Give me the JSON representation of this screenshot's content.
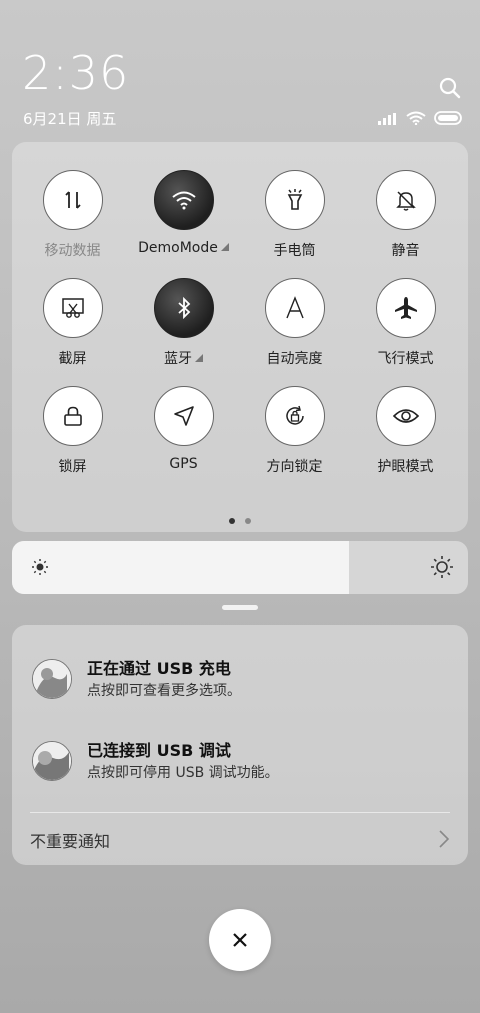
{
  "status_bar": {
    "time": "2:36",
    "date": "6月21日 周五"
  },
  "quick_settings": {
    "tiles": [
      {
        "label": "移动数据",
        "icon": "mobile-data-icon",
        "active": false,
        "disabled": true
      },
      {
        "label": "DemoMode",
        "icon": "wifi-icon",
        "active": true,
        "expand": true
      },
      {
        "label": "手电筒",
        "icon": "flashlight-icon",
        "active": false
      },
      {
        "label": "静音",
        "icon": "bell-off-icon",
        "active": false
      },
      {
        "label": "截屏",
        "icon": "screenshot-icon",
        "active": false
      },
      {
        "label": "蓝牙",
        "icon": "bluetooth-icon",
        "active": true,
        "expand": true
      },
      {
        "label": "自动亮度",
        "icon": "auto-brightness-icon",
        "active": false
      },
      {
        "label": "飞行模式",
        "icon": "airplane-icon",
        "active": false
      },
      {
        "label": "锁屏",
        "icon": "lock-icon",
        "active": false
      },
      {
        "label": "GPS",
        "icon": "gps-icon",
        "active": false
      },
      {
        "label": "方向锁定",
        "icon": "rotation-lock-icon",
        "active": false
      },
      {
        "label": "护眼模式",
        "icon": "eye-icon",
        "active": false
      }
    ],
    "page_count": 2,
    "current_page": 1
  },
  "brightness": {
    "level": 0.74
  },
  "notifications": {
    "items": [
      {
        "title": "正在通过 USB 充电",
        "body": "点按即可查看更多选项。"
      },
      {
        "title": "已连接到 USB 调试",
        "body": "点按即可停用 USB 调试功能。"
      }
    ],
    "unimportant_label": "不重要通知"
  }
}
